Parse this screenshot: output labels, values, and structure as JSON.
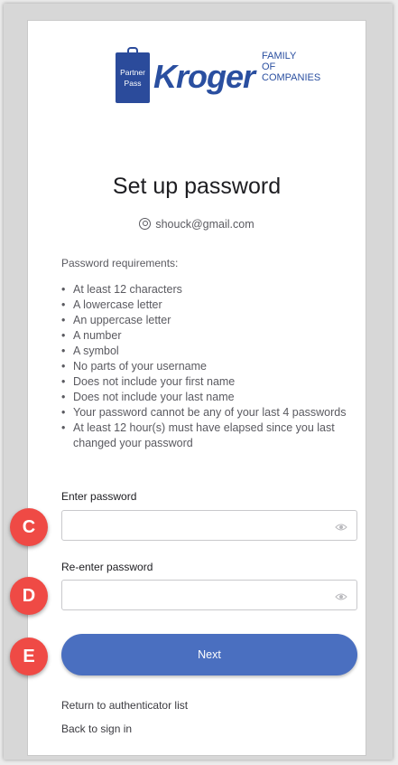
{
  "logo": {
    "badge_line1": "Partner",
    "badge_line2": "Pass",
    "brand": "Kroger",
    "family_line1": "FAMILY",
    "family_line2": "OF",
    "family_line3": "COMPANIES"
  },
  "page": {
    "title": "Set up password",
    "username": "shouck@gmail.com"
  },
  "requirements": {
    "heading": "Password requirements:",
    "items": [
      "At least 12 characters",
      "A lowercase letter",
      "An uppercase letter",
      "A number",
      "A symbol",
      "No parts of your username",
      "Does not include your first name",
      "Does not include your last name",
      "Your password cannot be any of your last 4 passwords",
      "At least 12 hour(s) must have elapsed since you last changed your password"
    ]
  },
  "form": {
    "password_label": "Enter password",
    "password_value": "",
    "reenter_label": "Re-enter password",
    "reenter_value": "",
    "next_label": "Next"
  },
  "callouts": {
    "c": "C",
    "d": "D",
    "e": "E"
  },
  "links": {
    "return_label": "Return to authenticator list",
    "back_label": "Back to sign in"
  },
  "colors": {
    "brand_blue": "#2a4fa0",
    "button_blue": "#4a6fc0",
    "callout_red": "#ef4a45"
  }
}
